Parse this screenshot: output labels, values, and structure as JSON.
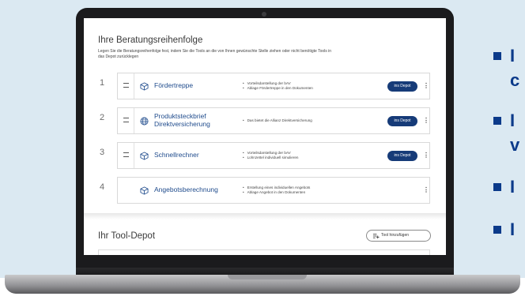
{
  "beratung": {
    "title": "Ihre Beratungsreihenfolge",
    "description": "Legen Sie die Beratungsreihenfolge fest, indem Sie die Tools an die von Ihnen gewünschte Stelle ziehen oder nicht benötigte Tools in das Depot zurücklegen",
    "depot_button_label": "ins Depot",
    "tools": [
      {
        "number": "1",
        "name_line1": "Fördertreppe",
        "name_line2": "",
        "icon": "cube-icon",
        "bullets": [
          "Vorteilsdarstellung der bAV",
          "Ablage Fördertreppe in den Dokumenten"
        ],
        "has_depot_button": true
      },
      {
        "number": "2",
        "name_line1": "Produktsteckbrief",
        "name_line2": "Direktversicherung",
        "icon": "globe-icon",
        "bullets": [
          "Das bietet die Allianz Direktversicherung"
        ],
        "has_depot_button": true
      },
      {
        "number": "3",
        "name_line1": "Schnellrechner",
        "name_line2": "",
        "icon": "cube-icon",
        "bullets": [
          "Vorteilsdarstellung der bAV",
          "Lohnzettel individuell simulieren"
        ],
        "has_depot_button": true
      },
      {
        "number": "4",
        "name_line1": "Angebotsberechnung",
        "name_line2": "",
        "icon": "cube-icon",
        "bullets": [
          "Erstellung eines individuellen Angebots",
          "Ablage Angebot in den Dokumenten"
        ],
        "has_depot_button": false
      }
    ]
  },
  "depot": {
    "title": "Ihr Tool-Depot",
    "add_button_label": "Tool hinzufügen"
  },
  "colors": {
    "accent": "#163b78",
    "link": "#1f4b8c",
    "background_panel": "#dbe9f2",
    "bullet_square": "#0b3a8a"
  }
}
